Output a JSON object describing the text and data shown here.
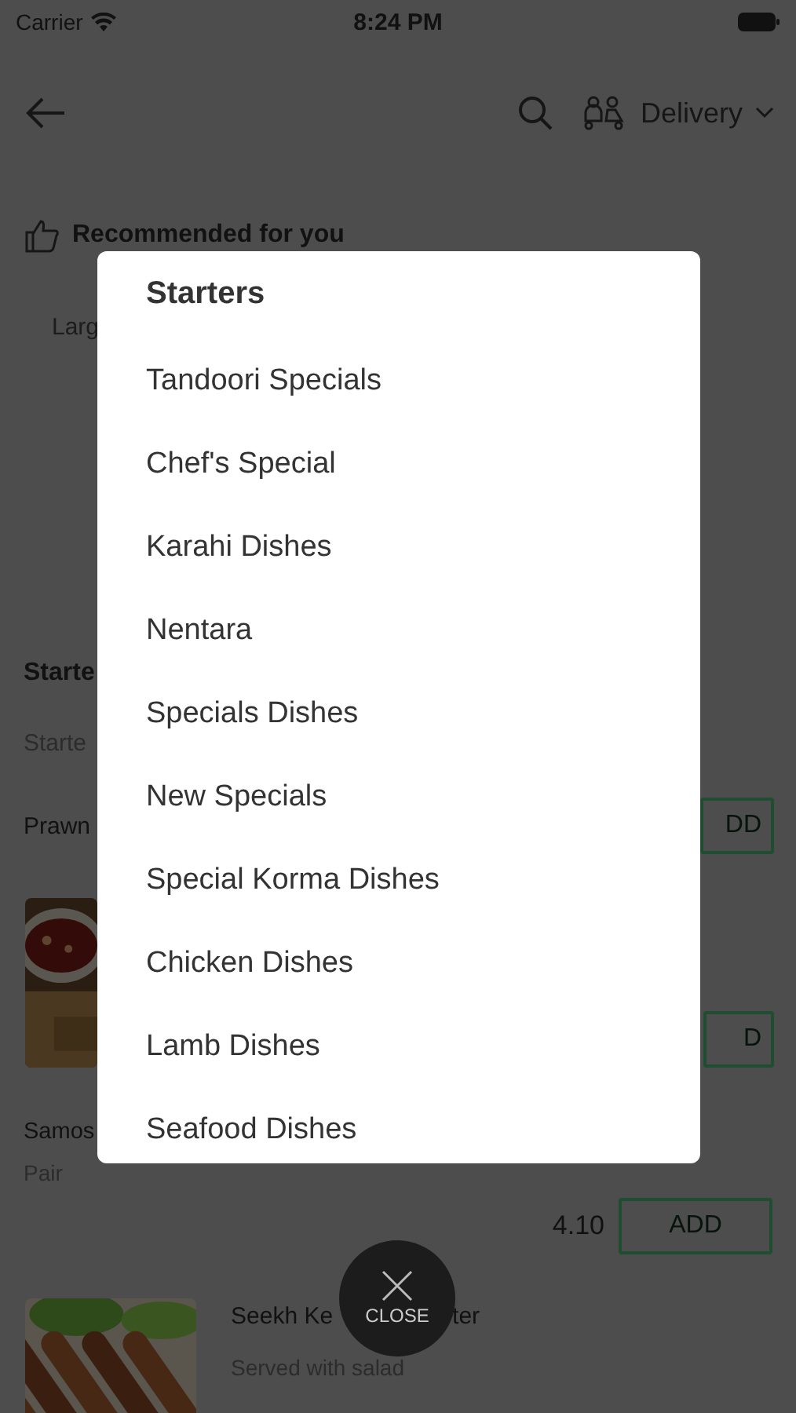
{
  "status_bar": {
    "carrier": "Carrier",
    "time": "8:24 PM"
  },
  "header": {
    "delivery_mode": "Delivery"
  },
  "recommended": {
    "title": "Recommended for you",
    "item_fragment": "Larg"
  },
  "menu_behind": {
    "section_title": "Starte",
    "section_subtitle": "Starte",
    "rows": [
      {
        "kind": "text",
        "name": "Prawn",
        "button": "DD"
      },
      {
        "button": "D"
      },
      {
        "kind": "detail",
        "name": "Samos",
        "description": "Pair"
      },
      {
        "kind": "price",
        "price": "4.10",
        "button": "ADD"
      },
      {
        "kind": "photo_detail",
        "name_parts": [
          "Seekh Ke",
          "ter"
        ],
        "description": "Served with salad"
      }
    ]
  },
  "category_picker": {
    "title": "Starters",
    "categories": [
      "Tandoori Specials",
      "Chef's Special",
      "Karahi Dishes",
      "Nentara",
      "Specials Dishes",
      "New Specials",
      "Special Korma Dishes",
      "Chicken Dishes",
      "Lamb Dishes",
      "Seafood Dishes"
    ]
  },
  "close_button": {
    "label": "CLOSE"
  }
}
